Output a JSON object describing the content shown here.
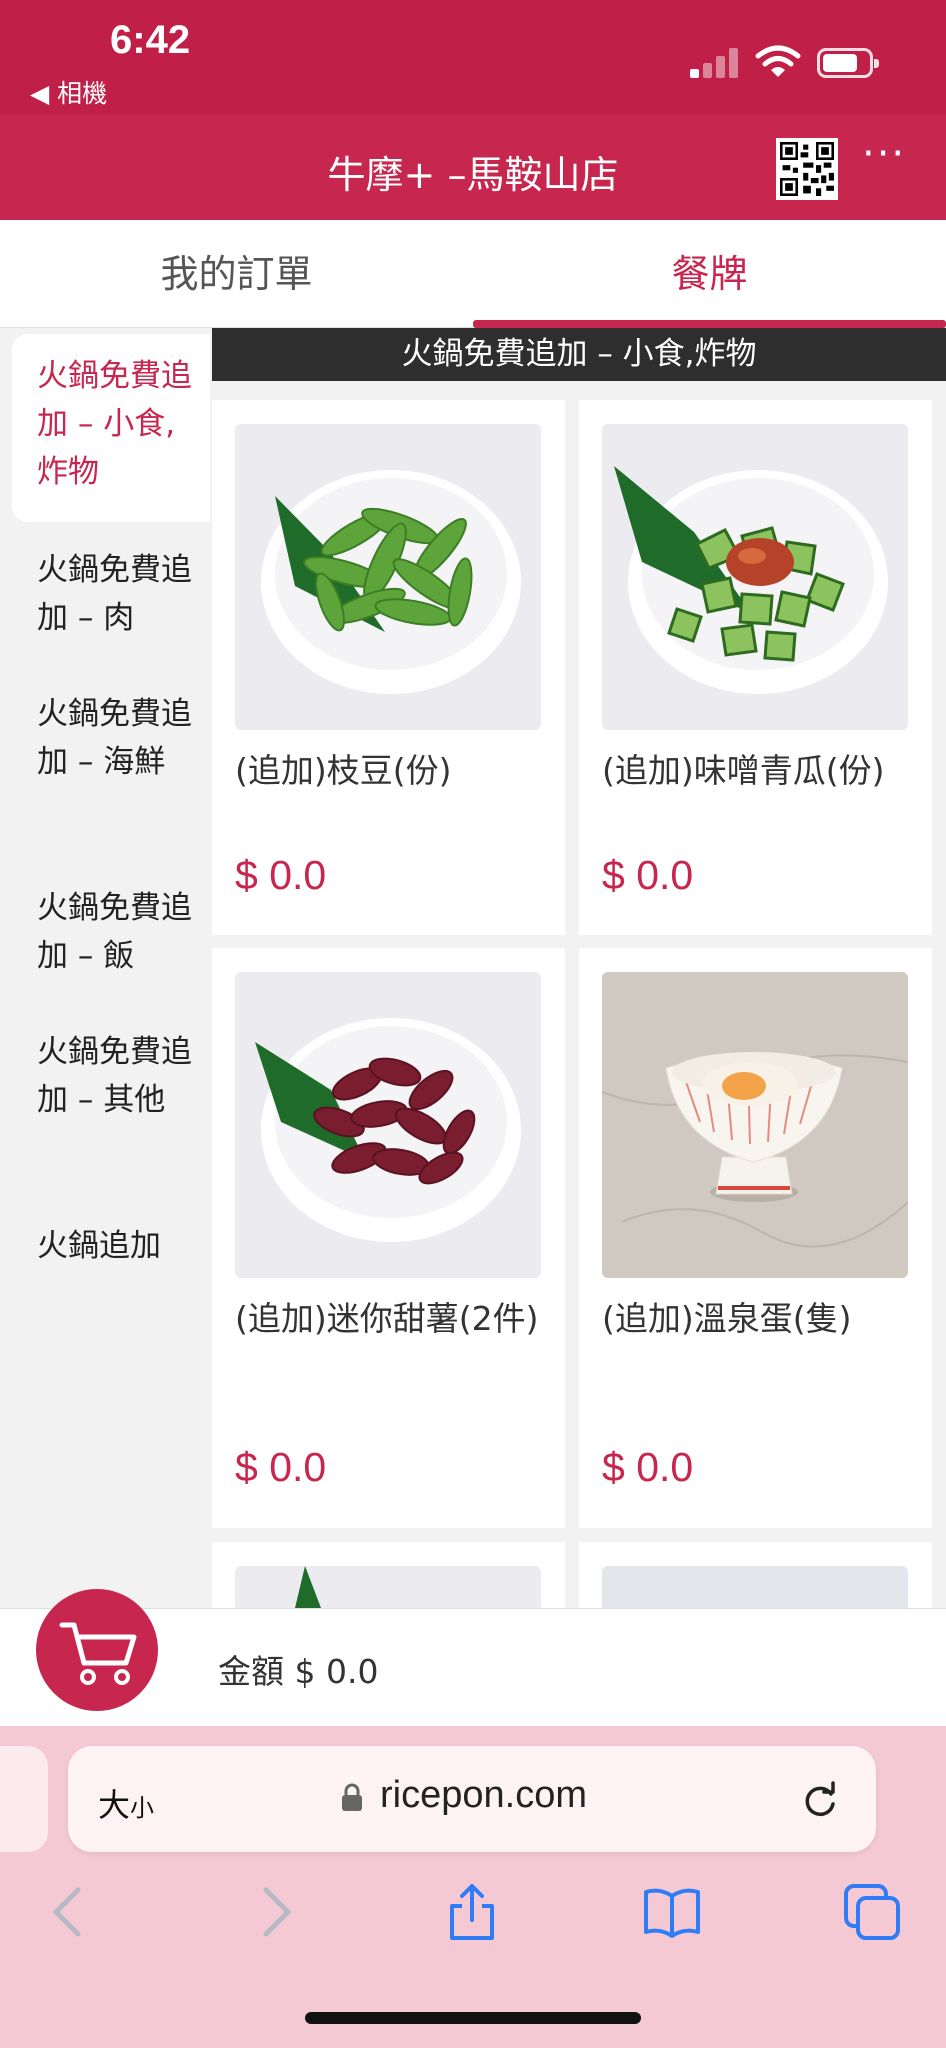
{
  "status_bar": {
    "time": "6:42",
    "back_label": "◀ 相機"
  },
  "header": {
    "title": "牛摩+ –馬鞍山店",
    "more_label": "···"
  },
  "tabs": [
    {
      "label": "我的訂單",
      "active": false
    },
    {
      "label": "餐牌",
      "active": true
    }
  ],
  "sidebar": {
    "items": [
      {
        "label": "火鍋免費追加 – 小食,炸物",
        "active": true
      },
      {
        "label": "火鍋免費追加 – 肉",
        "active": false
      },
      {
        "label": "火鍋免費追加 – 海鮮",
        "active": false
      },
      {
        "label": "火鍋免費追加 – 飯",
        "active": false
      },
      {
        "label": "火鍋免費追加 – 其他",
        "active": false
      },
      {
        "label": "火鍋追加",
        "active": false
      }
    ]
  },
  "section_title": "火鍋免費追加 – 小食,炸物",
  "products": [
    {
      "name": "(追加)枝豆(份)",
      "price": "$ 0.0"
    },
    {
      "name": "(追加)味噌青瓜(份)",
      "price": "$ 0.0"
    },
    {
      "name": "(追加)迷你甜薯(2件)",
      "price": "$ 0.0"
    },
    {
      "name": "(追加)溫泉蛋(隻)",
      "price": "$ 0.0"
    }
  ],
  "cart": {
    "total_label": "金額 $ 0.0"
  },
  "browser": {
    "text_size_big": "大",
    "text_size_small": "小",
    "url": "ricepon.com"
  },
  "colors": {
    "brand": "#c7264e",
    "status_bar": "#c01f48",
    "browser_chrome": "#f5c9d3",
    "ios_blue": "#2f7cf6"
  }
}
